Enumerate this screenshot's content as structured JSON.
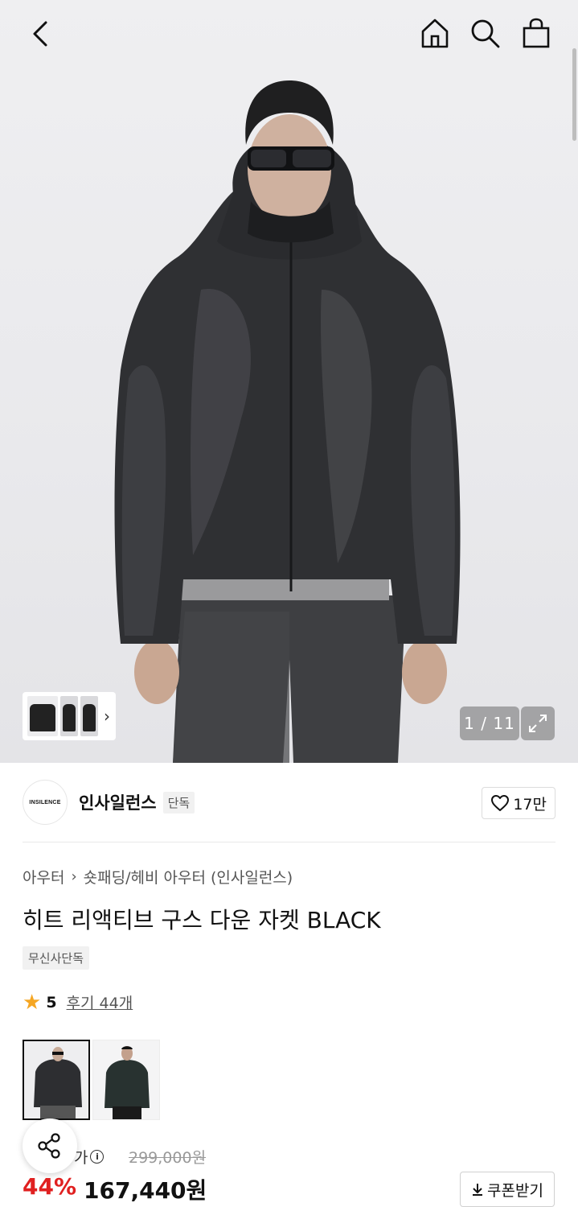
{
  "header": {
    "icons": [
      "back-arrow-icon",
      "home-icon",
      "search-icon",
      "shopping-bag-icon"
    ]
  },
  "gallery": {
    "counter": "1 / 11",
    "expand_icon": "expand-icon"
  },
  "brand": {
    "logo_text": "INSILENCE",
    "name": "인사일런스",
    "exclusive_tag": "단독",
    "likes": "17만"
  },
  "product": {
    "breadcrumb": [
      "아우터",
      "숏패딩/헤비 아우터 (인사일런스)"
    ],
    "title": "히트 리액티브 구스 다운 자켓 BLACK",
    "badge": "무신사단독",
    "rating": "5",
    "review_link": "후기 44개"
  },
  "price": {
    "label": "정상가",
    "label_visible": "가",
    "original": "299,000원",
    "discount": "44%",
    "sale": "167,440원",
    "coupon_button": "쿠폰받기"
  },
  "colors": {
    "star": "#f5a623",
    "discount": "#e02020"
  }
}
